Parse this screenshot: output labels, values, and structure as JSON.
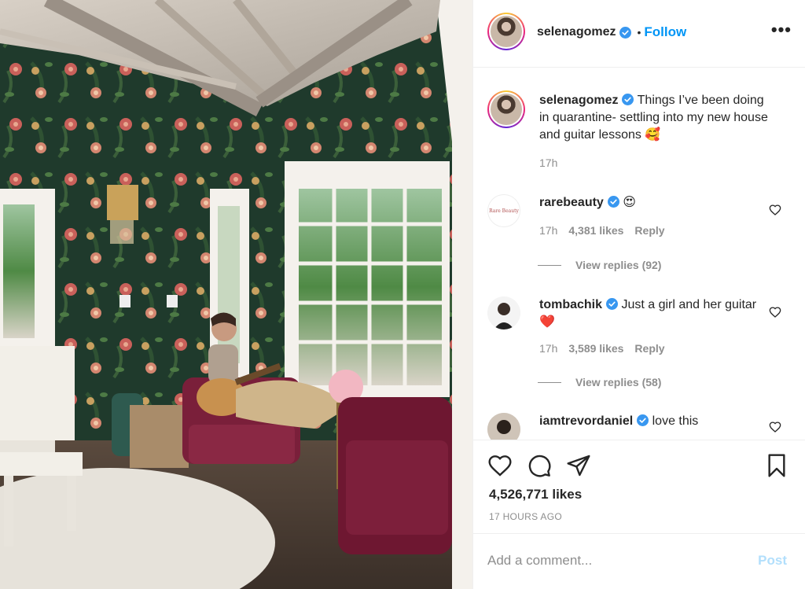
{
  "post": {
    "username": "selenagomez",
    "follow_label": "Follow",
    "dot": "•",
    "more_label": "•••"
  },
  "caption": {
    "username": "selenagomez",
    "text": "Things I’ve been doing in quarantine- settling into my new house and guitar lessons 🥰",
    "time": "17h"
  },
  "comments": [
    {
      "username": "rarebeauty",
      "avatar_text": "Rare Beauty",
      "text": "😍",
      "time": "17h",
      "likes": "4,381 likes",
      "reply_label": "Reply",
      "view_replies": "View replies (92)"
    },
    {
      "username": "tombachik",
      "text": "Just a girl and her guitar❤️",
      "time": "17h",
      "likes": "3,589 likes",
      "reply_label": "Reply",
      "view_replies": "View replies (58)"
    },
    {
      "username": "iamtrevordaniel",
      "text": "love this"
    }
  ],
  "actions": {
    "likes_count": "4,526,771 likes",
    "timestamp": "17 HOURS AGO",
    "icons": [
      "heart-icon",
      "comment-icon",
      "share-icon",
      "bookmark-icon"
    ]
  },
  "comment_box": {
    "placeholder": "Add a comment...",
    "post_label": "Post"
  },
  "colors": {
    "link_blue": "#0095f6",
    "post_disabled": "#b2dffc",
    "secondary_text": "#8e8e8e",
    "verified_blue": "#3897f0"
  }
}
